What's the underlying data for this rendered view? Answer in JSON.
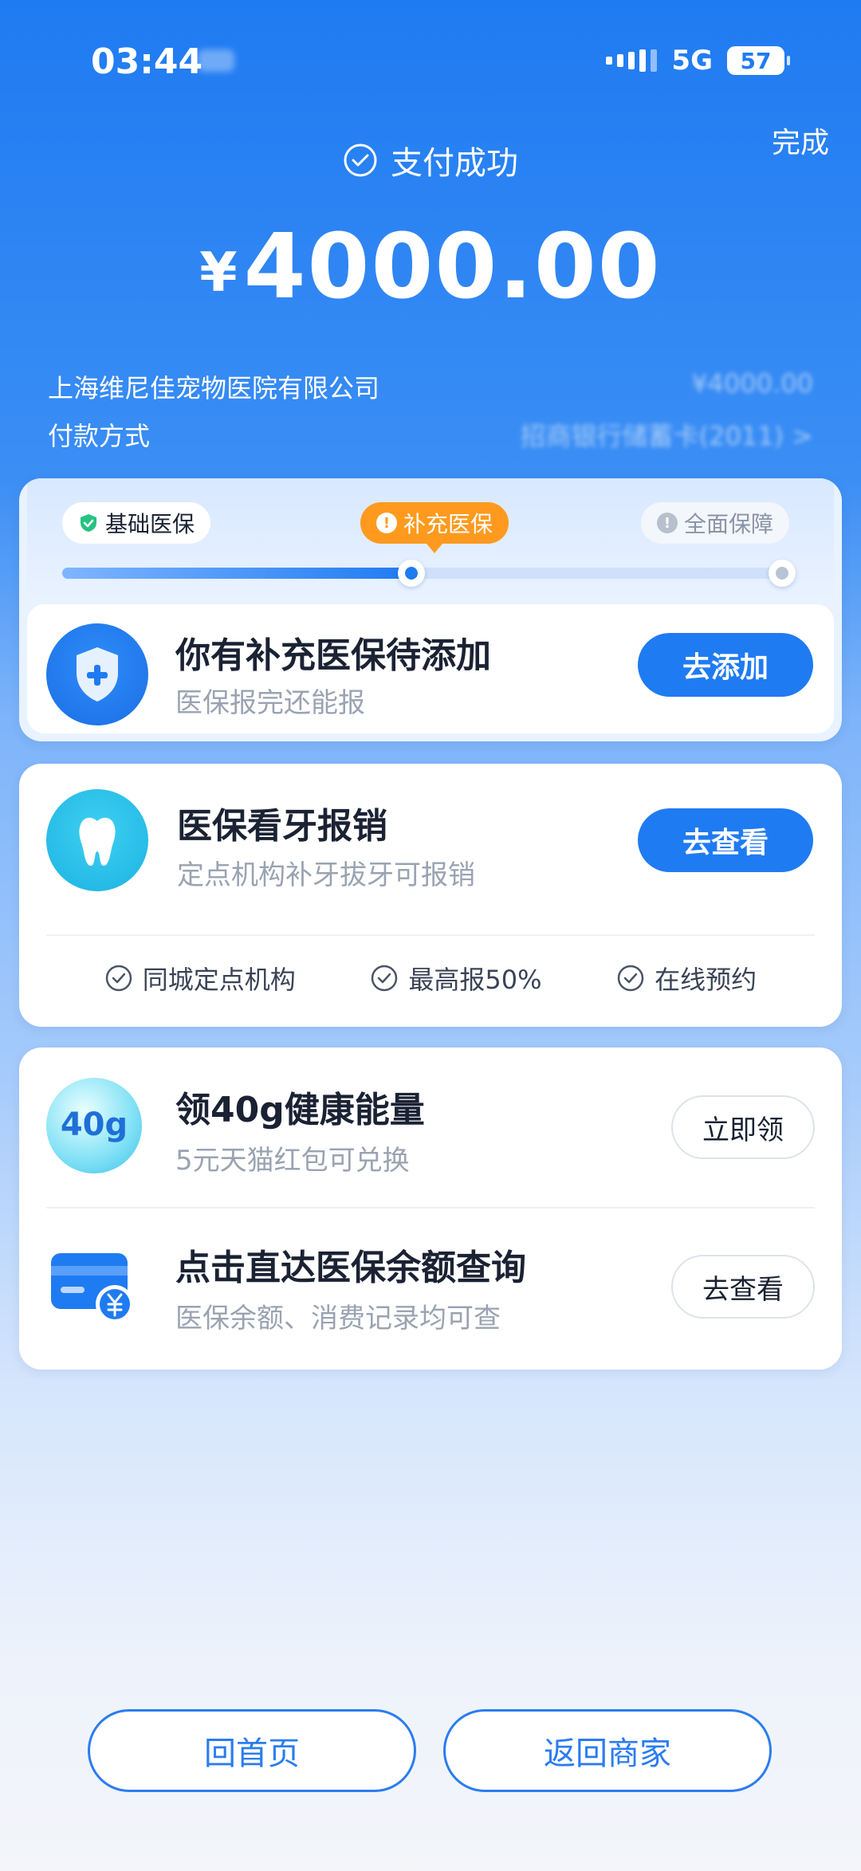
{
  "status_bar": {
    "time": "03:44",
    "network": "5G",
    "battery": "57"
  },
  "header": {
    "done_label": "完成",
    "pay_status": "支付成功",
    "currency": "¥",
    "amount": "4000.00"
  },
  "details": {
    "merchant": "上海维尼佳宠物医院有限公司",
    "merchant_amount": "¥4000.00",
    "method_label": "付款方式",
    "method_value": "招商银行储蓄卡(2011) >"
  },
  "insurance_progress": {
    "steps": [
      "基础医保",
      "补充医保",
      "全面保障"
    ],
    "current_step": 2,
    "progress_fraction": 0.5
  },
  "supplement_card": {
    "title": "你有补充医保待添加",
    "subtitle": "医保报完还能报",
    "button": "去添加"
  },
  "dental_card": {
    "title": "医保看牙报销",
    "subtitle": "定点机构补牙拔牙可报销",
    "button": "去查看",
    "features": [
      "同城定点机构",
      "最高报50%",
      "在线预约"
    ]
  },
  "energy_item": {
    "badge": "40g",
    "title": "领40g健康能量",
    "subtitle": "5元天猫红包可兑换",
    "button": "立即领"
  },
  "balance_item": {
    "title": "点击直达医保余额查询",
    "subtitle": "医保余额、消费记录均可查",
    "button": "去查看"
  },
  "bottom_buttons": {
    "home": "回首页",
    "merchant": "返回商家"
  },
  "colors": {
    "primary": "#1f7bf2",
    "accent_orange": "#ff9a1f",
    "success_green": "#26c281"
  }
}
